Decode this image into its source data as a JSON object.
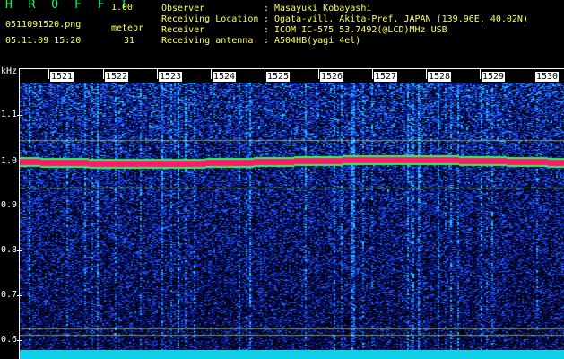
{
  "header": {
    "app_title": "H R O F F T",
    "version": "1.00",
    "filename": "0511091520.png",
    "meteor_label": "meteor",
    "datetime": "05.11.09 15:20",
    "meteor_count": "31"
  },
  "info": [
    {
      "label": "Observer",
      "value": "Masayuki Kobayashi"
    },
    {
      "label": "Receiving Location",
      "value": "Ogata-vill. Akita-Pref. JAPAN (139.96E, 40.02N)"
    },
    {
      "label": "Receiver",
      "value": "ICOM IC-575 53.7492(@LCD)MHz USB"
    },
    {
      "label": "Receiving antenna",
      "value": "A504HB(yagi 4el)"
    }
  ],
  "info_separator": ":",
  "y_axis": {
    "unit": "kHz",
    "ticks": [
      "1.1",
      "1.0",
      "0.9",
      "0.8",
      "0.7",
      "0.6"
    ]
  },
  "x_axis": {
    "ticks": [
      "1521",
      "1522",
      "1523",
      "1524",
      "1525",
      "1526",
      "1527",
      "1528",
      "1529",
      "1530"
    ]
  },
  "colors": {
    "background": "#000000",
    "noise_low": "#0a1a8a",
    "noise_mid": "#1f5cff",
    "noise_high": "#27c4ff",
    "carrier": "#ff1a6e",
    "carrier_edge": "#22ff55",
    "guide_line": "#d8ff40",
    "baseline": "#10d0e8"
  }
}
